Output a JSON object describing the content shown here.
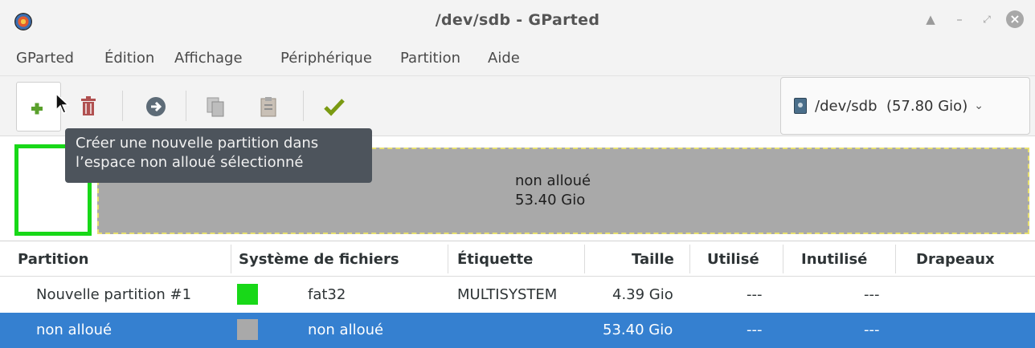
{
  "window": {
    "title": "/dev/sdb - GParted"
  },
  "menu": [
    "GParted",
    "Édition",
    "Affichage",
    "Périphérique",
    "Partition",
    "Aide"
  ],
  "toolbar": {
    "icons": [
      "new-partition-icon",
      "delete-icon",
      "resize-move-icon",
      "copy-icon",
      "paste-icon",
      "apply-icon"
    ],
    "device": "/dev/sdb  (57.80 Gio)"
  },
  "tooltip": {
    "line1": "Créer une nouvelle partition dans",
    "line2": "l’espace non alloué sélectionné"
  },
  "diskmap": {
    "label": "non alloué",
    "size": "53.40 Gio"
  },
  "table": {
    "headers": [
      "Partition",
      "Système de fichiers",
      "Étiquette",
      "Taille",
      "Utilisé",
      "Inutilisé",
      "Drapeaux"
    ],
    "rows": [
      {
        "partition": "Nouvelle partition #1",
        "fs_color": "#18d818",
        "filesystem": "fat32",
        "label": "MULTISYSTEM",
        "size": "4.39 Gio",
        "used": "---",
        "unused": "---",
        "flags": ""
      },
      {
        "partition": "non alloué",
        "fs_color": "#a9a9a9",
        "filesystem": "non alloué",
        "label": "",
        "size": "53.40 Gio",
        "used": "---",
        "unused": "---",
        "flags": ""
      }
    ]
  },
  "colors": {
    "selection": "#3580d0",
    "partition_fat32": "#18d818",
    "unallocated": "#a9a9a9",
    "tooltip_bg": "#4d545c"
  }
}
